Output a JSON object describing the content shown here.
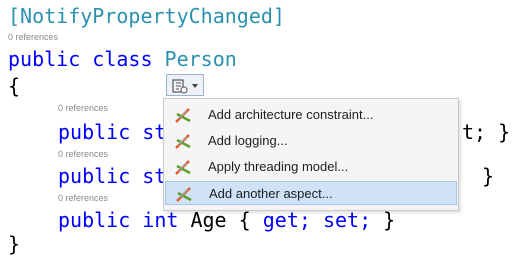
{
  "editor": {
    "attribute_line": "[NotifyPropertyChanged]",
    "class_refs": "0 references",
    "class_keyword_line": "public class ",
    "class_name": "Person",
    "open_brace": "{",
    "close_brace": "}",
    "member1_refs": "0 references",
    "member1_prefix": "public st",
    "member1_tail": "t; }",
    "member2_refs": "0 references",
    "member2_prefix": "public st",
    "member2_tail": "}",
    "member3_refs": "0 references",
    "member3_public": "public",
    "member3_int": "int",
    "member3_name": "Age",
    "member3_open": "{",
    "member3_get": "get;",
    "member3_set": "set;",
    "member3_close": "}"
  },
  "smart_tag": {
    "icon": "aspect-lightbulb-icon",
    "dropdown_icon": "chevron-down-icon"
  },
  "context_menu": {
    "items": [
      {
        "label": "Add architecture constraint...",
        "icon": "postsharp-aspect-icon",
        "selected": false
      },
      {
        "label": "Add logging...",
        "icon": "postsharp-aspect-icon",
        "selected": false
      },
      {
        "label": "Apply threading model...",
        "icon": "postsharp-aspect-icon",
        "selected": false
      },
      {
        "label": "Add another aspect...",
        "icon": "postsharp-aspect-icon",
        "selected": true
      }
    ]
  },
  "colors": {
    "keyword": "#0000ff",
    "type": "#2b91af",
    "attribute": "#2b91af",
    "text": "#000000",
    "menu_selection": "#cfe2f7",
    "refs_text": "#8a8a8a"
  }
}
